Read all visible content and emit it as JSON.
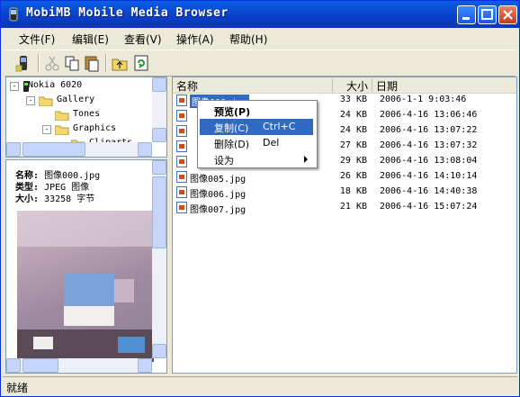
{
  "window": {
    "title": "MobiMB Mobile Media Browser"
  },
  "menu": [
    {
      "label": "文件(F)"
    },
    {
      "label": "编辑(E)"
    },
    {
      "label": "查看(V)"
    },
    {
      "label": "操作(A)"
    },
    {
      "label": "帮助(H)"
    }
  ],
  "toolbar": {
    "buttons": [
      {
        "icon": "phone-connect-icon"
      },
      {
        "icon": "cut-icon"
      },
      {
        "icon": "copy-icon"
      },
      {
        "icon": "paste-icon"
      },
      {
        "icon": "up-folder-icon"
      },
      {
        "icon": "refresh-icon"
      }
    ]
  },
  "tree": {
    "items": [
      {
        "label": "Nokia 6020",
        "expander": "-",
        "icon": "phone-icon"
      },
      {
        "label": "Gallery",
        "expander": "-",
        "icon": "folder-icon"
      },
      {
        "label": "Tones",
        "expander": "",
        "icon": "folder-icon"
      },
      {
        "label": "Graphics",
        "expander": "-",
        "icon": "folder-icon"
      },
      {
        "label": "Cliparts",
        "expander": "",
        "icon": "folder-icon"
      }
    ]
  },
  "info": {
    "name_label": "名称:",
    "name_value": "图像000.jpg",
    "type_label": "类型:",
    "type_value": "JPEG 图像",
    "size_label": "大小:",
    "size_value": "33258 字节"
  },
  "list": {
    "columns": [
      "名称",
      "大小",
      "日期"
    ],
    "rows": [
      {
        "name": "图像000.jpg",
        "size": "33 KB",
        "date": "2006-1-1 9:03:46"
      },
      {
        "name": "",
        "size": "24 KB",
        "date": "2006-4-16 13:06:46"
      },
      {
        "name": "",
        "size": "24 KB",
        "date": "2006-4-16 13:07:22"
      },
      {
        "name": "",
        "size": "27 KB",
        "date": "2006-4-16 13:07:32"
      },
      {
        "name": "",
        "size": "29 KB",
        "date": "2006-4-16 13:08:04"
      },
      {
        "name": "图像005.jpg",
        "size": "26 KB",
        "date": "2006-4-16 14:10:14"
      },
      {
        "name": "图像006.jpg",
        "size": "18 KB",
        "date": "2006-4-16 14:40:38"
      },
      {
        "name": "图像007.jpg",
        "size": "21 KB",
        "date": "2006-4-16 15:07:24"
      }
    ]
  },
  "context_menu": {
    "items": [
      {
        "label": "预览(P)",
        "shortcut": ""
      },
      {
        "label": "复制(C)",
        "shortcut": "Ctrl+C"
      },
      {
        "label": "删除(D)",
        "shortcut": "Del"
      },
      {
        "label": "设为",
        "shortcut": ""
      }
    ]
  },
  "status": {
    "text": "就绪"
  },
  "colors": {
    "titlebar": "#0a3ec7",
    "selection": "#316ac5"
  }
}
